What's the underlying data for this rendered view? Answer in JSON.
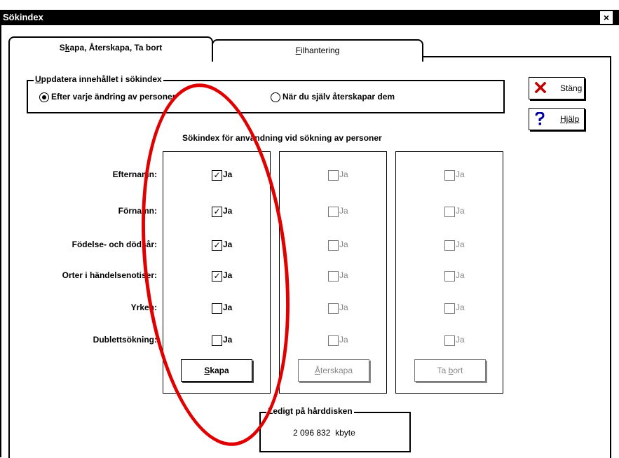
{
  "window": {
    "title": "Sökindex",
    "close_glyph": "×"
  },
  "tabs": [
    {
      "label_pre": "S",
      "label_mn": "k",
      "label_post": "apa, Återskapa, Ta bort"
    },
    {
      "label_pre": "",
      "label_mn": "F",
      "label_post": "ilhantering"
    }
  ],
  "update_group": {
    "legend_pre": "",
    "legend_mn": "U",
    "legend_post": "ppdatera innehållet i sökindex",
    "option1": "Efter varje ändring av personer",
    "option2": "När du själv återskapar dem"
  },
  "side_buttons": {
    "close_label": "Stäng",
    "help_label": "Hjälp",
    "close_icon": "x-icon",
    "help_icon": "question-icon",
    "close_icon_color": "#c00000",
    "help_icon_color": "#0000a0"
  },
  "index_section": {
    "heading": "Sökindex för användning vid sökning av personer",
    "rows": [
      "Efternamn:",
      "Förnamn:",
      "Födelse- och dödsår:",
      "Orter i händelsenotiser:",
      "Yrken:",
      "Dublettsökning:"
    ],
    "checkbox_label": "Ja",
    "create_checked": [
      true,
      true,
      true,
      true,
      false,
      false
    ]
  },
  "actions": {
    "create_pre": "",
    "create_mn": "S",
    "create_post": "kapa",
    "recreate_pre": "",
    "recreate_mn": "Å",
    "recreate_post": "terskapa",
    "delete_pre": "Ta ",
    "delete_mn": "b",
    "delete_post": "ort"
  },
  "disk": {
    "legend": "Ledigt på hårddisken",
    "value": "2 096 832",
    "unit": "kbyte"
  },
  "annotation": {
    "color": "#e00000"
  }
}
